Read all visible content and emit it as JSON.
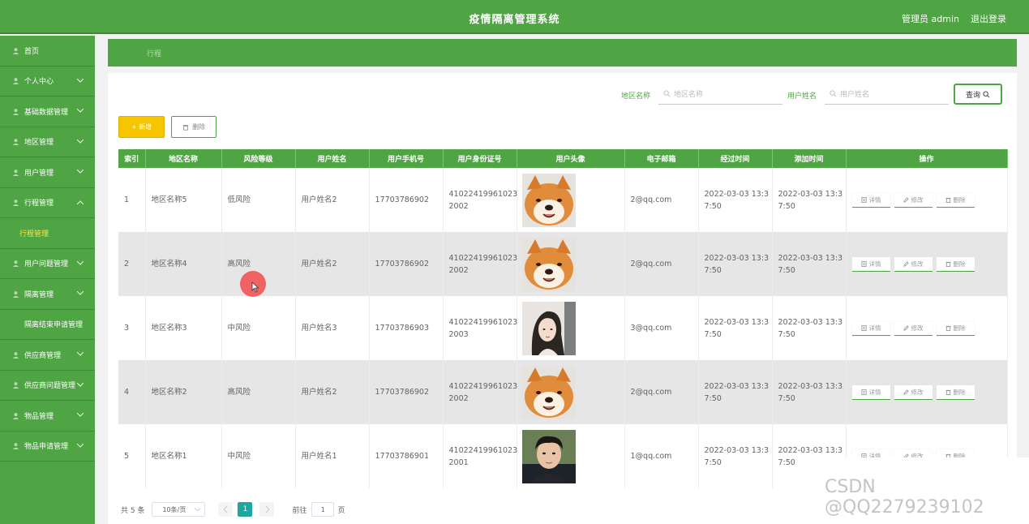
{
  "header": {
    "title": "疫情隔离管理系统",
    "user": "管理员 admin",
    "logout": "退出登录"
  },
  "colors": {
    "primary": "#4fa444",
    "add_button": "#f6c500",
    "active_page": "#1ca89f"
  },
  "sidebar": {
    "items": [
      {
        "label": "首页",
        "icon": "home-icon",
        "chevron": false
      },
      {
        "label": "个人中心",
        "icon": "user-icon",
        "chevron": true
      },
      {
        "label": "基础数据管理",
        "icon": "data-icon",
        "chevron": true
      },
      {
        "label": "地区管理",
        "icon": "map-icon",
        "chevron": true
      },
      {
        "label": "用户管理",
        "icon": "users-icon",
        "chevron": true
      },
      {
        "label": "行程管理",
        "icon": "route-icon",
        "chevron": "up"
      },
      {
        "label": "行程管理",
        "icon": "",
        "chevron": false,
        "sub": true
      },
      {
        "label": "用户问题管理",
        "icon": "question-icon",
        "chevron": true
      },
      {
        "label": "隔离管理",
        "icon": "isolation-icon",
        "chevron": true
      },
      {
        "label": "隔离结束申请管理",
        "icon": "",
        "chevron": false
      },
      {
        "label": "供应商管理",
        "icon": "supplier-icon",
        "chevron": true
      },
      {
        "label": "供应商问题管理",
        "icon": "question-icon",
        "chevron": true
      },
      {
        "label": "物品管理",
        "icon": "box-icon",
        "chevron": true
      },
      {
        "label": "物品申请管理",
        "icon": "apply-icon",
        "chevron": true
      }
    ]
  },
  "breadcrumb": {
    "current": "行程"
  },
  "search": {
    "region_label": "地区名称",
    "region_placeholder": "地区名称",
    "user_label": "用户姓名",
    "user_placeholder": "用户姓名",
    "query_button": "查询"
  },
  "actions": {
    "add": "+ 新增",
    "delete": "删除"
  },
  "table": {
    "headers": [
      "索引",
      "地区名称",
      "风险等级",
      "用户姓名",
      "用户手机号",
      "用户身份证号",
      "用户头像",
      "电子邮箱",
      "经过时间",
      "添加时间",
      "操作"
    ],
    "op_labels": {
      "detail": "详情",
      "edit": "修改",
      "delete": "删除"
    },
    "rows": [
      {
        "index": "1",
        "region": "地区名称5",
        "risk": "低风险",
        "name": "用户姓名2",
        "phone": "17703786902",
        "id_line1": "41022419961023",
        "id_line2": "2002",
        "avatar": "shiba-dog",
        "email": "2@qq.com",
        "pass_line1": "2022-03-03 13:3",
        "pass_line2": "7:50",
        "add_line1": "2022-03-03 13:3",
        "add_line2": "7:50"
      },
      {
        "index": "2",
        "region": "地区名称4",
        "risk": "高风险",
        "name": "用户姓名2",
        "phone": "17703786902",
        "id_line1": "41022419961023",
        "id_line2": "2002",
        "avatar": "shiba-dog",
        "email": "2@qq.com",
        "pass_line1": "2022-03-03 13:3",
        "pass_line2": "7:50",
        "add_line1": "2022-03-03 13:3",
        "add_line2": "7:50"
      },
      {
        "index": "3",
        "region": "地区名称3",
        "risk": "中风险",
        "name": "用户姓名3",
        "phone": "17703786903",
        "id_line1": "41022419961023",
        "id_line2": "2003",
        "avatar": "illustrated-woman",
        "email": "3@qq.com",
        "pass_line1": "2022-03-03 13:3",
        "pass_line2": "7:50",
        "add_line1": "2022-03-03 13:3",
        "add_line2": "7:50"
      },
      {
        "index": "4",
        "region": "地区名称2",
        "risk": "高风险",
        "name": "用户姓名2",
        "phone": "17703786902",
        "id_line1": "41022419961023",
        "id_line2": "2002",
        "avatar": "shiba-dog",
        "email": "2@qq.com",
        "pass_line1": "2022-03-03 13:3",
        "pass_line2": "7:50",
        "add_line1": "2022-03-03 13:3",
        "add_line2": "7:50"
      },
      {
        "index": "5",
        "region": "地区名称1",
        "risk": "中风险",
        "name": "用户姓名1",
        "phone": "17703786901",
        "id_line1": "41022419961023",
        "id_line2": "2001",
        "avatar": "man-photo",
        "email": "1@qq.com",
        "pass_line1": "2022-03-03 13:3",
        "pass_line2": "7:50",
        "add_line1": "2022-03-03 13:3",
        "add_line2": "7:50"
      }
    ]
  },
  "pagination": {
    "total": "共 5 条",
    "page_size": "10条/页",
    "current_page": "1",
    "goto_label": "前往",
    "goto_value": "1",
    "goto_unit": "页"
  },
  "watermark": "CSDN @QQ2279239102"
}
